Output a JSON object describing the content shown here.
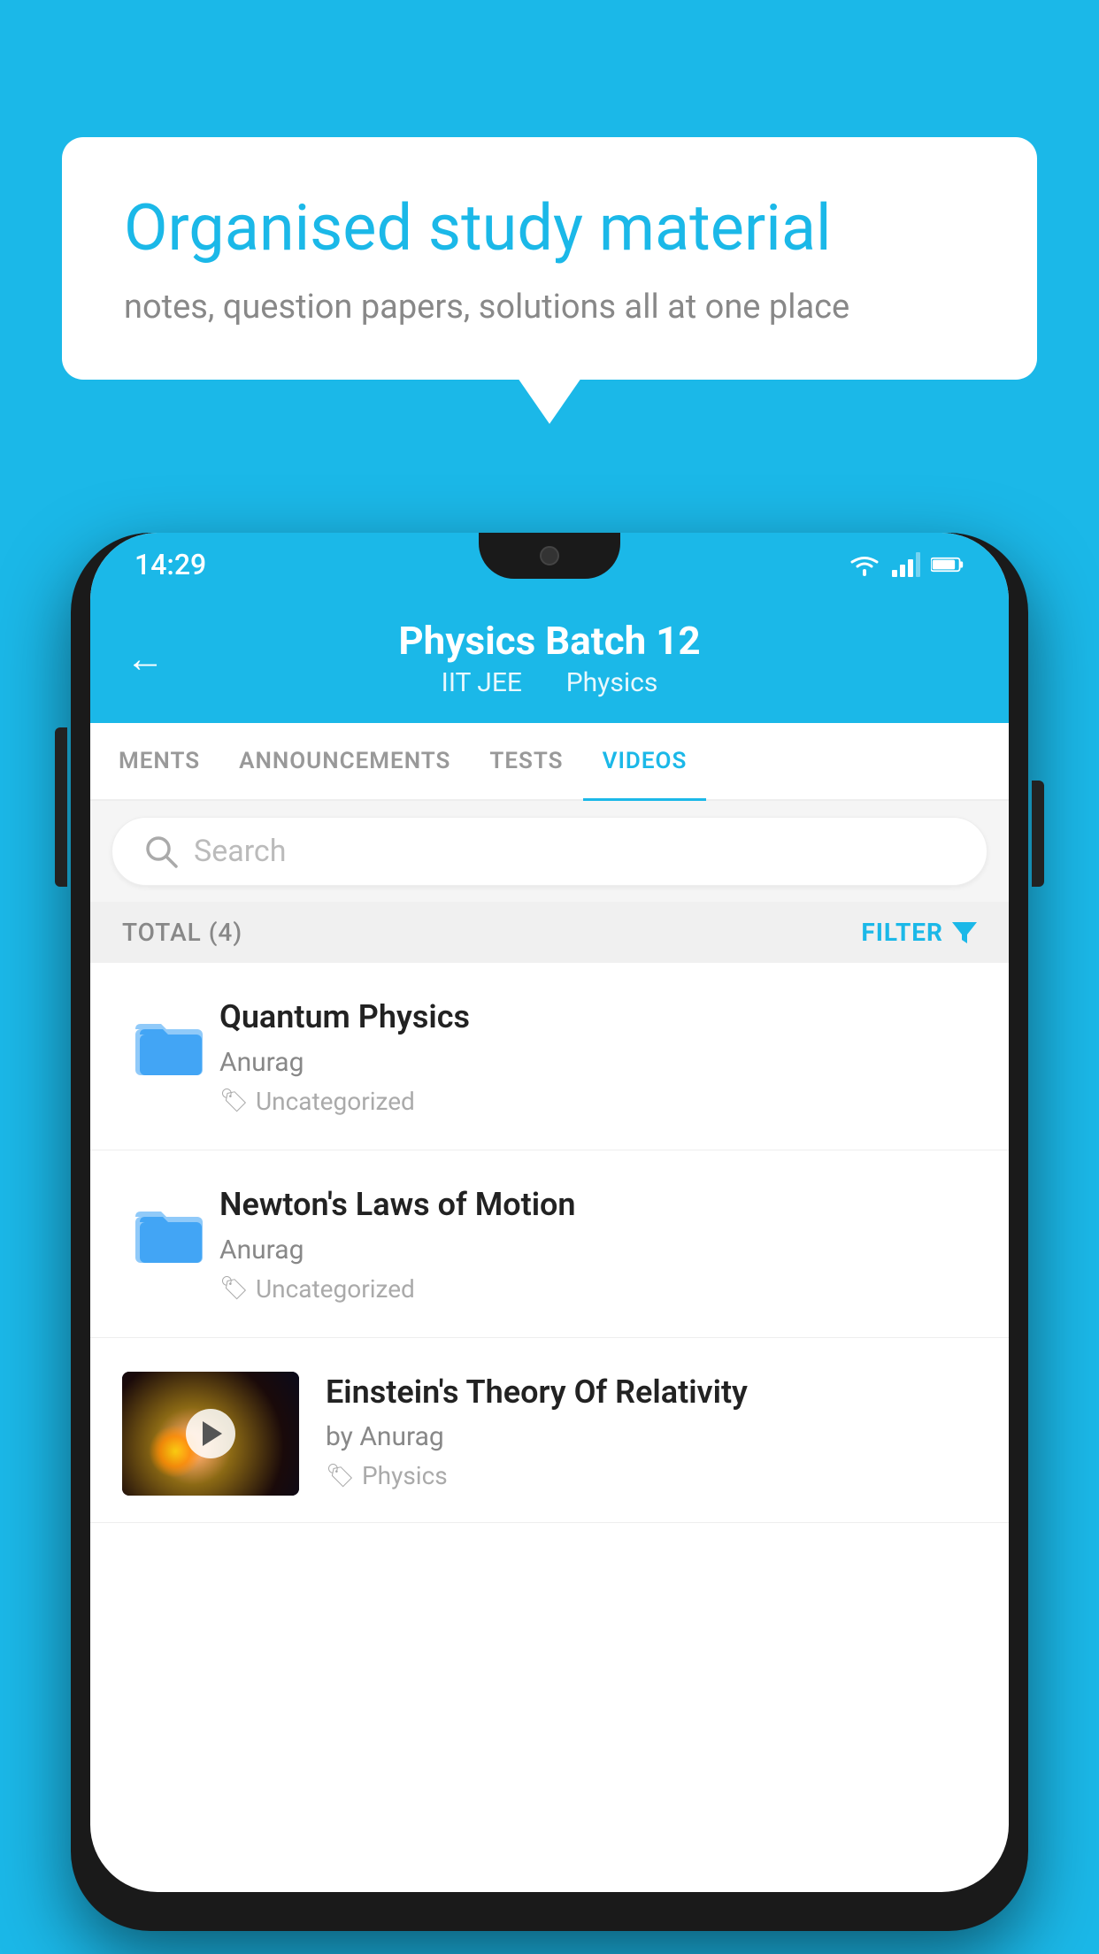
{
  "background_color": "#1BB8E8",
  "bubble": {
    "title": "Organised study material",
    "subtitle": "notes, question papers, solutions all at one place"
  },
  "status_bar": {
    "time": "14:29",
    "wifi": "wifi",
    "signal": "signal",
    "battery": "battery"
  },
  "header": {
    "title": "Physics Batch 12",
    "subtitle_part1": "IIT JEE",
    "subtitle_part2": "Physics",
    "back_label": "back"
  },
  "tabs": [
    {
      "label": "MENTS",
      "active": false
    },
    {
      "label": "ANNOUNCEMENTS",
      "active": false
    },
    {
      "label": "TESTS",
      "active": false
    },
    {
      "label": "VIDEOS",
      "active": true
    }
  ],
  "search": {
    "placeholder": "Search"
  },
  "filter_bar": {
    "total_label": "TOTAL (4)",
    "filter_label": "FILTER"
  },
  "videos": [
    {
      "title": "Quantum Physics",
      "author": "Anurag",
      "tag": "Uncategorized",
      "type": "folder"
    },
    {
      "title": "Newton's Laws of Motion",
      "author": "Anurag",
      "tag": "Uncategorized",
      "type": "folder"
    },
    {
      "title": "Einstein's Theory Of Relativity",
      "author": "by Anurag",
      "tag": "Physics",
      "type": "video"
    }
  ]
}
